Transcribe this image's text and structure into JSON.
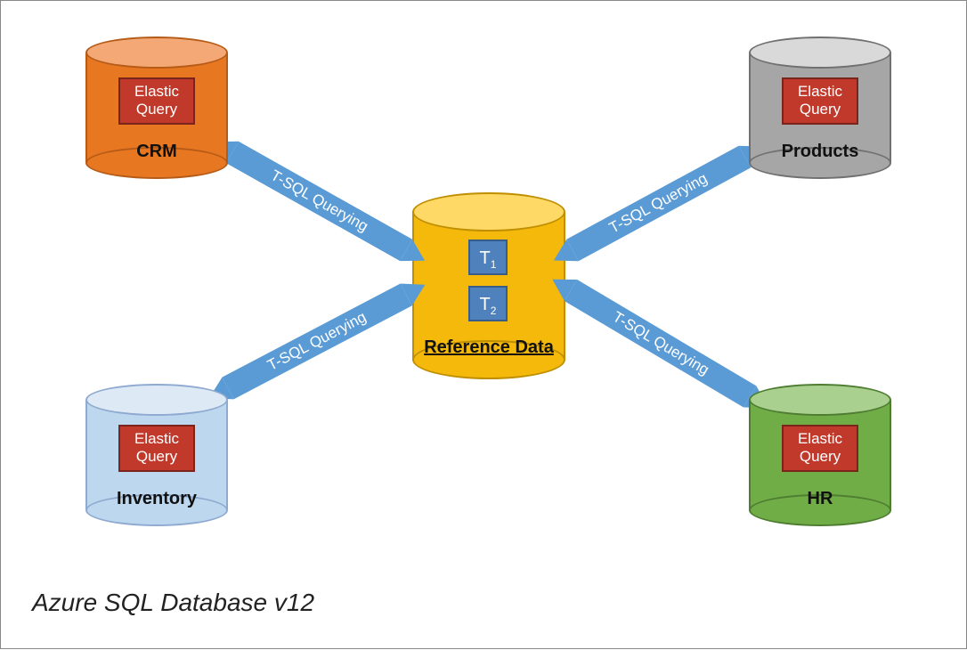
{
  "caption": "Azure SQL Database v12",
  "center": {
    "label": "Reference Data",
    "tables": [
      "T1",
      "T2"
    ]
  },
  "arrows": {
    "nw": "T-SQL Querying",
    "ne": "T-SQL Querying",
    "sw": "T-SQL Querying",
    "se": "T-SQL Querying"
  },
  "nodes": {
    "crm": {
      "label": "CRM",
      "badge": "Elastic Query"
    },
    "products": {
      "label": "Products",
      "badge": "Elastic Query"
    },
    "inventory": {
      "label": "Inventory",
      "badge": "Elastic Query"
    },
    "hr": {
      "label": "HR",
      "badge": "Elastic Query"
    }
  },
  "colors": {
    "crm": {
      "top": "#f3a875",
      "side": "#e87722",
      "border": "#b55b17"
    },
    "products": {
      "top": "#d9d9d9",
      "side": "#a6a6a6",
      "border": "#707070"
    },
    "inventory": {
      "top": "#ddeaf6",
      "side": "#bdd7ee",
      "border": "#8faad0"
    },
    "hr": {
      "top": "#a9d08e",
      "side": "#70ad47",
      "border": "#4e7d31"
    },
    "center": {
      "top": "#ffd966",
      "side": "#f4b90b",
      "border": "#bf8f00"
    },
    "arrow": "#5b9bd5"
  }
}
